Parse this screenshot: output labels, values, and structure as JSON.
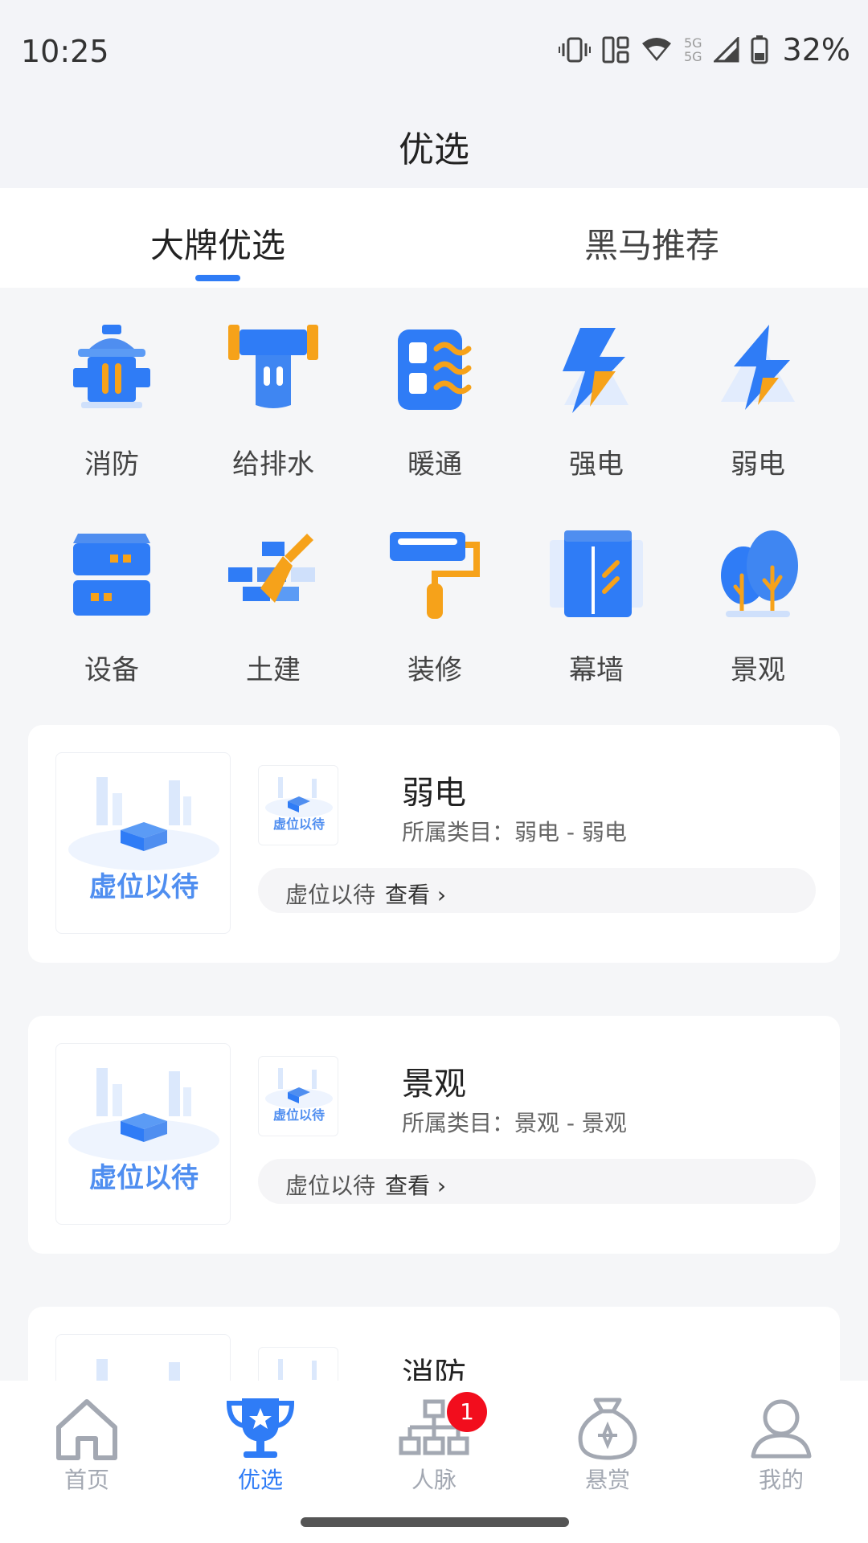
{
  "status_bar": {
    "time": "10:25",
    "network_label": "5G",
    "battery_percent": "32%",
    "icons": [
      "vibrate-icon",
      "data-saver-icon",
      "wifi-icon",
      "signal-icon",
      "battery-icon"
    ]
  },
  "header": {
    "title": "优选"
  },
  "tabs": [
    {
      "label": "大牌优选",
      "active": true
    },
    {
      "label": "黑马推荐",
      "active": false
    }
  ],
  "categories": [
    {
      "label": "消防",
      "icon": "fire-hydrant-icon"
    },
    {
      "label": "给排水",
      "icon": "water-pipe-icon"
    },
    {
      "label": "暖通",
      "icon": "hvac-icon"
    },
    {
      "label": "强电",
      "icon": "strong-electric-icon"
    },
    {
      "label": "弱电",
      "icon": "weak-electric-icon"
    },
    {
      "label": "设备",
      "icon": "equipment-icon"
    },
    {
      "label": "土建",
      "icon": "construction-icon"
    },
    {
      "label": "装修",
      "icon": "paint-roller-icon"
    },
    {
      "label": "幕墙",
      "icon": "curtain-wall-icon"
    },
    {
      "label": "景观",
      "icon": "landscape-tree-icon"
    }
  ],
  "placeholder_image_text": "虚位以待",
  "cards": [
    {
      "title": "弱电",
      "category_line": "所属类目：弱电 - 弱电",
      "pill_text": "虚位以待",
      "view_label": "查看"
    },
    {
      "title": "景观",
      "category_line": "所属类目：景观 - 景观",
      "pill_text": "虚位以待",
      "view_label": "查看"
    },
    {
      "title": "消防",
      "category_line": "",
      "pill_text": "",
      "view_label": ""
    }
  ],
  "bottom_nav": [
    {
      "label": "首页",
      "icon": "home-icon",
      "active": false
    },
    {
      "label": "优选",
      "icon": "trophy-icon",
      "active": true
    },
    {
      "label": "人脉",
      "icon": "network-icon",
      "active": false,
      "badge": "1"
    },
    {
      "label": "悬赏",
      "icon": "money-bag-icon",
      "active": false
    },
    {
      "label": "我的",
      "icon": "user-icon",
      "active": false
    }
  ],
  "colors": {
    "accent": "#2f7cf6",
    "icon_orange": "#f6a21a",
    "badge_red": "#f20d1d",
    "page_bg": "#f5f6f8"
  }
}
